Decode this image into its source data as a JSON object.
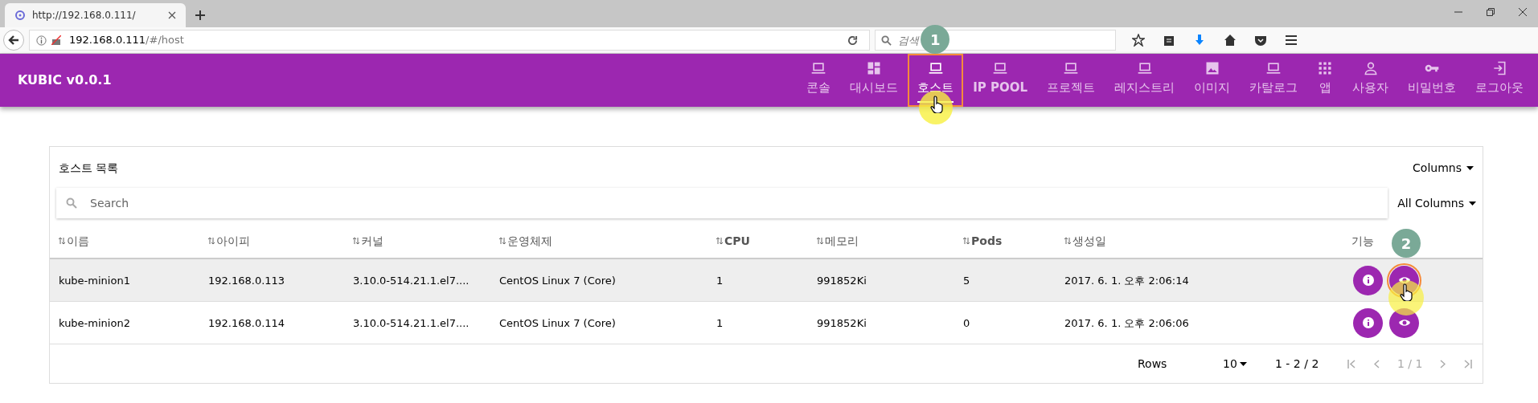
{
  "browser": {
    "tab_title": "http://192.168.0.111/",
    "url_host": "192.168.0.111",
    "url_path": "/#/host",
    "search_placeholder": "검색"
  },
  "app": {
    "title": "KUBIC v0.0.1",
    "nav": [
      {
        "label": "콘솔",
        "kind": "laptop",
        "selected": false,
        "bold": false,
        "highlighted": false
      },
      {
        "label": "대시보드",
        "kind": "dashboard",
        "selected": false,
        "bold": false,
        "highlighted": false
      },
      {
        "label": "호스트",
        "kind": "laptop",
        "selected": true,
        "bold": false,
        "highlighted": true,
        "step": "1"
      },
      {
        "label": "IP POOL",
        "kind": "laptop",
        "selected": false,
        "bold": true,
        "highlighted": false
      },
      {
        "label": "프로젝트",
        "kind": "laptop",
        "selected": false,
        "bold": false,
        "highlighted": false
      },
      {
        "label": "레지스트리",
        "kind": "laptop",
        "selected": false,
        "bold": false,
        "highlighted": false
      },
      {
        "label": "이미지",
        "kind": "image",
        "selected": false,
        "bold": false,
        "highlighted": false
      },
      {
        "label": "카탈로그",
        "kind": "laptop",
        "selected": false,
        "bold": false,
        "highlighted": false
      },
      {
        "label": "앱",
        "kind": "apps",
        "selected": false,
        "bold": false,
        "highlighted": false
      },
      {
        "label": "사용자",
        "kind": "person",
        "selected": false,
        "bold": false,
        "highlighted": false
      },
      {
        "label": "비밀번호",
        "kind": "key",
        "selected": false,
        "bold": false,
        "highlighted": false
      },
      {
        "label": "로그아웃",
        "kind": "logout",
        "selected": false,
        "bold": false,
        "highlighted": false
      }
    ]
  },
  "table": {
    "title": "호스트 목록",
    "columns_button": "Columns",
    "search_placeholder": "Search",
    "filter": "All Columns",
    "columns": [
      {
        "label": "이름",
        "sortable": true,
        "bold": false
      },
      {
        "label": "아이피",
        "sortable": true,
        "bold": false
      },
      {
        "label": "커널",
        "sortable": true,
        "bold": false
      },
      {
        "label": "운영체제",
        "sortable": true,
        "bold": false
      },
      {
        "label": "CPU",
        "sortable": true,
        "bold": true
      },
      {
        "label": "메모리",
        "sortable": true,
        "bold": false
      },
      {
        "label": "Pods",
        "sortable": true,
        "bold": true
      },
      {
        "label": "생성일",
        "sortable": true,
        "bold": false
      },
      {
        "label": "기능",
        "sortable": false,
        "bold": false
      }
    ],
    "rows": [
      {
        "cells": [
          "kube-minion1",
          "192.168.0.113",
          "3.10.0-514.21.1.el7....",
          "CentOS Linux 7 (Core)",
          "1",
          "991852Ki",
          "5",
          "2017. 6. 1. 오후 2:06:14"
        ],
        "hovered": true,
        "actions": [
          {
            "kind": "info",
            "highlighted": false
          },
          {
            "kind": "eye",
            "highlighted": true,
            "step": "2"
          }
        ]
      },
      {
        "cells": [
          "kube-minion2",
          "192.168.0.114",
          "3.10.0-514.21.1.el7....",
          "CentOS Linux 7 (Core)",
          "1",
          "991852Ki",
          "0",
          "2017. 6. 1. 오후 2:06:06"
        ],
        "hovered": false,
        "actions": [
          {
            "kind": "info",
            "highlighted": false
          },
          {
            "kind": "eye",
            "highlighted": false
          }
        ]
      }
    ],
    "pagination": {
      "rows_label": "Rows",
      "page_size": "10",
      "range": "1 - 2 / 2",
      "page": "1 / 1"
    }
  }
}
